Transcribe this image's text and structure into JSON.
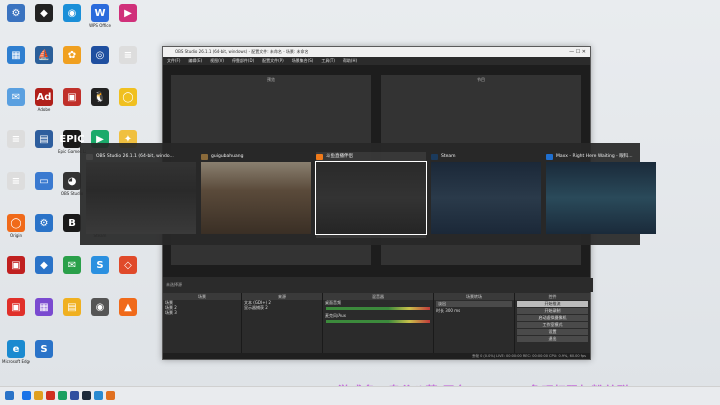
{
  "obs": {
    "title": "OBS Studio 26.1.1 (64-bit, windows) - 配置文件: 未命名 - 场景: 未命名",
    "menu": [
      "文件(F)",
      "编辑(E)",
      "视图(V)",
      "停靠部件(D)",
      "配置文件(P)",
      "场景集合(S)",
      "工具(T)",
      "帮助(H)"
    ],
    "preview_left": "预览",
    "preview_right": "节目",
    "no_source": "未选择源",
    "dock": {
      "scenes_header": "场景",
      "scenes": [
        "场景",
        "场景 2",
        "场景 3"
      ],
      "sources_header": "来源",
      "sources": [
        "文本 (GDI+) 2",
        "显示器捕获 2"
      ],
      "mixer_header": "混音器",
      "mixer_labels": [
        "桌面音频",
        "麦克风/Aux"
      ],
      "transition_header": "场景转场",
      "transition_value": "淡出",
      "duration_label": "时长",
      "duration_value": "300 ms",
      "controls_header": "控件",
      "controls": [
        "开始推流",
        "开始录制",
        "启动虚拟摄像机",
        "工作室模式",
        "设置",
        "退出"
      ],
      "status": "丢帧 0 (0.0%)  LIVE: 00:00:00  REC: 00:00:00  CPU: 0.9%, 60.00 fps"
    }
  },
  "switcher": {
    "windows": [
      {
        "title": "OBS Studio 26.1.1 (64-bit, windo...",
        "icon_color": "#444444",
        "selected": false
      },
      {
        "title": "guigubahuang",
        "icon_color": "#8a6a3a",
        "selected": false
      },
      {
        "title": "斗鱼直播伴侣",
        "icon_color": "#f07a1a",
        "selected": true
      },
      {
        "title": "Steam",
        "icon_color": "#1b3a5c",
        "selected": false
      },
      {
        "title": "Maxx - Right Here Waiting - 眼科...",
        "icon_color": "#1f6fd0",
        "selected": false
      }
    ]
  },
  "banner": "游戏名：鬼谷八荒  平台：steam  鱼吧扫码加粉丝群",
  "desktop_icons": [
    {
      "label": "",
      "color": "#3a73c0",
      "glyph": "⚙"
    },
    {
      "label": "",
      "color": "#222222",
      "glyph": "◆"
    },
    {
      "label": "",
      "color": "#1a8fd8",
      "glyph": "◉"
    },
    {
      "label": "WPS Office",
      "color": "#2b6bdc",
      "glyph": "W"
    },
    {
      "label": "",
      "color": "#d0307a",
      "glyph": "▶"
    },
    {
      "label": "",
      "color": "#2f7fd0",
      "glyph": "▦"
    },
    {
      "label": "",
      "color": "#2b5f9a",
      "glyph": "⛵"
    },
    {
      "label": "",
      "color": "#f0a020",
      "glyph": "✿"
    },
    {
      "label": "",
      "color": "#1f4fa0",
      "glyph": "◎"
    },
    {
      "label": "",
      "color": "#dddddd",
      "glyph": "≡"
    },
    {
      "label": "",
      "color": "#5aa0e0",
      "glyph": "✉"
    },
    {
      "label": "Adobe",
      "color": "#b0201a",
      "glyph": "Ad"
    },
    {
      "label": "",
      "color": "#c0302a",
      "glyph": "▣"
    },
    {
      "label": "",
      "color": "#222222",
      "glyph": "🐧"
    },
    {
      "label": "",
      "color": "#f0c020",
      "glyph": "◯"
    },
    {
      "label": "",
      "color": "#dddddd",
      "glyph": "≡"
    },
    {
      "label": "",
      "color": "#2e5e9e",
      "glyph": "▤"
    },
    {
      "label": "Epic Games Launcher",
      "color": "#1a1a1a",
      "glyph": "EPIC"
    },
    {
      "label": "",
      "color": "#1aaa6a",
      "glyph": "▶"
    },
    {
      "label": "",
      "color": "#f0c040",
      "glyph": "✦"
    },
    {
      "label": "",
      "color": "#dddddd",
      "glyph": "≡"
    },
    {
      "label": "",
      "color": "#3a7ad0",
      "glyph": "▭"
    },
    {
      "label": "OBS Studio",
      "color": "#333333",
      "glyph": "◕"
    },
    {
      "label": "",
      "color": "#1aaa8a",
      "glyph": "▶"
    },
    {
      "label": "",
      "color": "#2a73c8",
      "glyph": "e"
    },
    {
      "label": "Origin",
      "color": "#f06a1a",
      "glyph": "◯"
    },
    {
      "label": "",
      "color": "#2a73c8",
      "glyph": "⚙"
    },
    {
      "label": "",
      "color": "#1a1a1a",
      "glyph": "B"
    },
    {
      "label": "Steam",
      "color": "#1b2838",
      "glyph": "◕"
    },
    {
      "label": "",
      "color": "#e0302a",
      "glyph": "◎"
    },
    {
      "label": "",
      "color": "#c02020",
      "glyph": "▣"
    },
    {
      "label": "",
      "color": "#2a73c8",
      "glyph": "◆"
    },
    {
      "label": "",
      "color": "#2aa04a",
      "glyph": "✉"
    },
    {
      "label": "",
      "color": "#2a90e0",
      "glyph": "S"
    },
    {
      "label": "",
      "color": "#e04a2a",
      "glyph": "◇"
    },
    {
      "label": "",
      "color": "#e0302a",
      "glyph": "▣"
    },
    {
      "label": "",
      "color": "#7a4ad0",
      "glyph": "▦"
    },
    {
      "label": "",
      "color": "#f0b020",
      "glyph": "▤"
    },
    {
      "label": "",
      "color": "#555555",
      "glyph": "◉"
    },
    {
      "label": "",
      "color": "#f06a1a",
      "glyph": "▲"
    },
    {
      "label": "Microsoft Edge",
      "color": "#1a8ad0",
      "glyph": "e"
    },
    {
      "label": "",
      "color": "#2a73c8",
      "glyph": "S"
    }
  ],
  "taskbar_colors": [
    "#1a73e8",
    "#e0a020",
    "#d03020",
    "#1aa060",
    "#3050a0",
    "#1b2838",
    "#2a8ad0",
    "#e07020"
  ]
}
